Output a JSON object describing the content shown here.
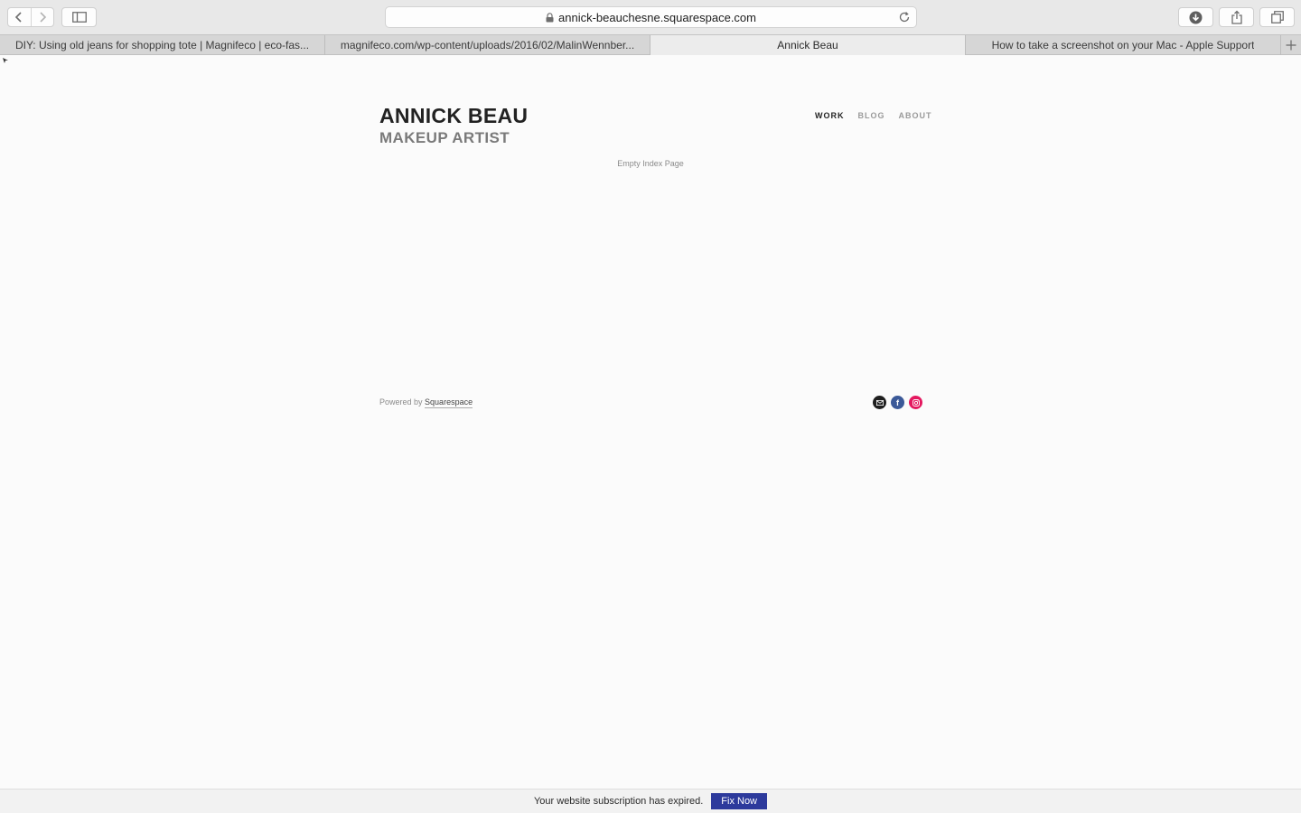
{
  "browser": {
    "url": "annick-beauchesne.squarespace.com",
    "tabs": [
      {
        "title": "DIY: Using old jeans for shopping tote | Magnifeco | eco-fas...",
        "active": false
      },
      {
        "title": "magnifeco.com/wp-content/uploads/2016/02/MalinWennber...",
        "active": false
      },
      {
        "title": "Annick Beau",
        "active": true
      },
      {
        "title": "How to take a screenshot on your Mac - Apple Support",
        "active": false
      }
    ],
    "icons": {
      "back": "chevron-left-icon",
      "forward": "chevron-right-icon",
      "sidebar": "sidebar-icon",
      "lock": "lock-icon",
      "reload": "reload-icon",
      "download": "download-icon",
      "share": "share-icon",
      "tabs": "tabs-overview-icon",
      "new_tab": "plus-icon"
    }
  },
  "site": {
    "title": "ANNICK BEAU",
    "tagline": "MAKEUP ARTIST",
    "nav": [
      {
        "label": "WORK",
        "current": true
      },
      {
        "label": "BLOG",
        "current": false
      },
      {
        "label": "ABOUT",
        "current": false
      }
    ],
    "empty_message": "Empty Index Page",
    "footer": {
      "powered_prefix": "Powered by",
      "powered_link": "Squarespace"
    },
    "social": [
      {
        "name": "email-icon",
        "color": "#1f1f1f"
      },
      {
        "name": "facebook-icon",
        "color": "#3b5998",
        "glyph": "f"
      },
      {
        "name": "instagram-icon",
        "color": "#e4185f"
      }
    ]
  },
  "banner": {
    "message": "Your website subscription has expired.",
    "button_label": "Fix Now",
    "button_color": "#2d3a9c"
  }
}
